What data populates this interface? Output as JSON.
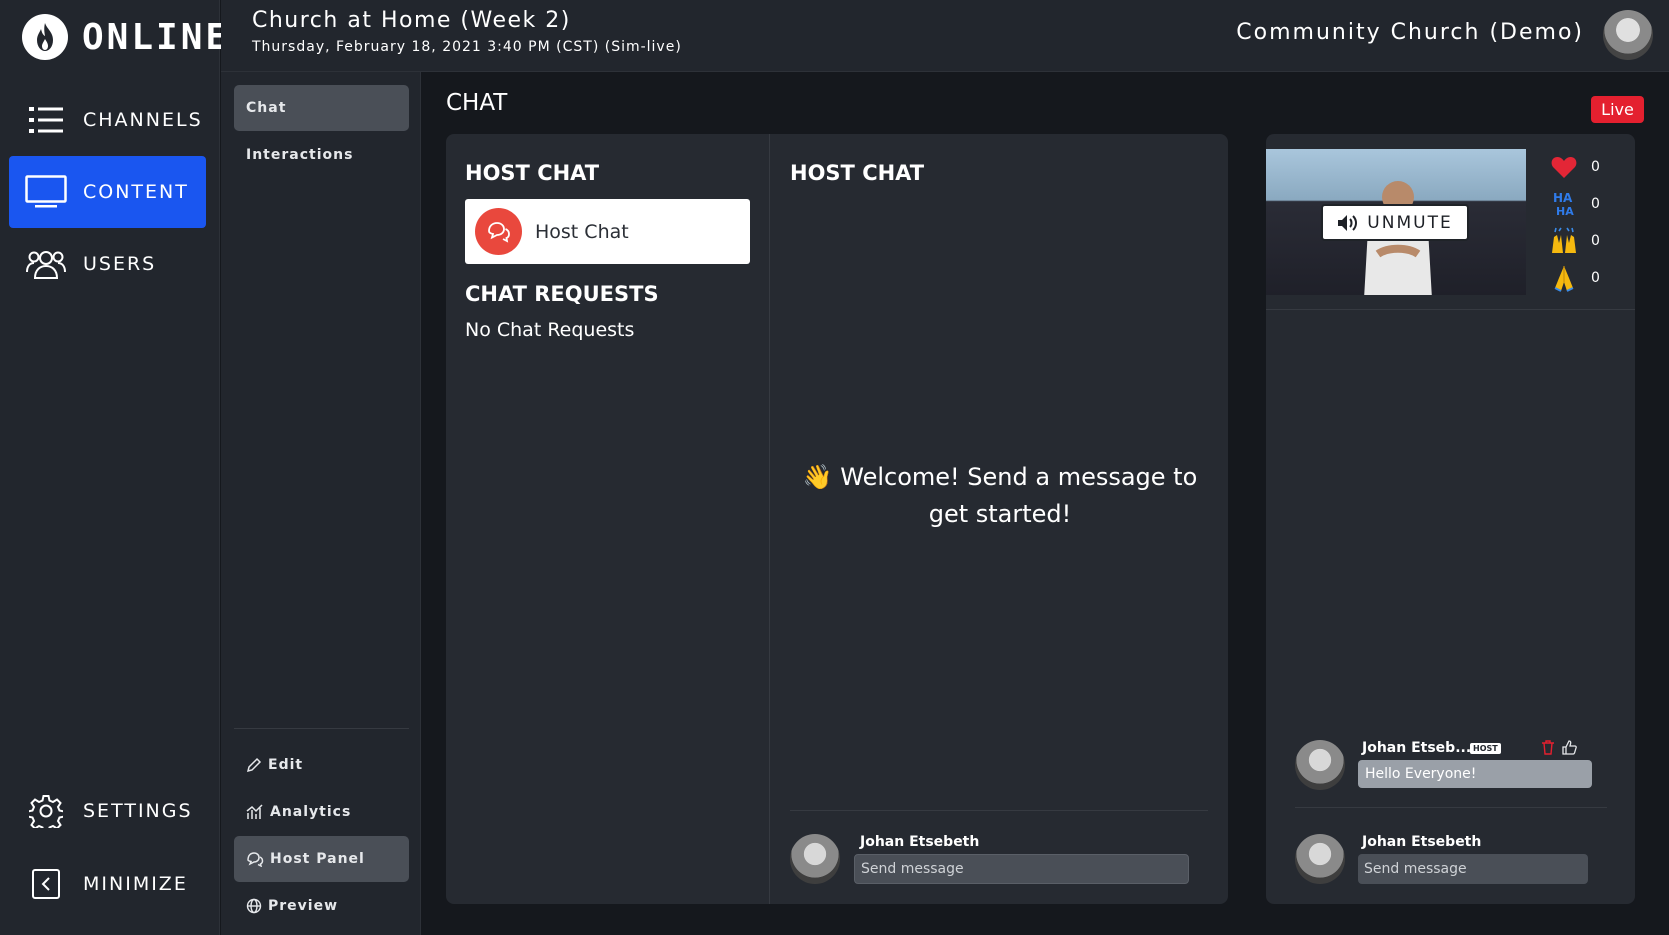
{
  "brand": {
    "logo_text": "ONLINE"
  },
  "nav": {
    "channels": "CHANNELS",
    "content": "CONTENT",
    "users": "USERS",
    "settings": "SETTINGS",
    "minimize": "MINIMIZE"
  },
  "subnav": {
    "chat": "Chat",
    "interactions": "Interactions",
    "edit": "Edit",
    "analytics": "Analytics",
    "host_panel": "Host Panel",
    "preview": "Preview"
  },
  "header": {
    "title": "Church at Home (Week 2)",
    "date": "Thursday, February 18, 2021 3:40 PM (CST) (Sim-live)",
    "org": "Community Church (Demo)"
  },
  "main": {
    "title": "CHAT",
    "live_badge": "Live",
    "host_chat_heading": "HOST CHAT",
    "host_chat_item": "Host Chat",
    "chat_requests_heading": "CHAT REQUESTS",
    "no_requests": "No Chat Requests",
    "right_heading": "HOST CHAT",
    "welcome_emoji": "👋",
    "welcome": "Welcome! Send a message to get started!",
    "compose_name": "Johan Etsebeth",
    "compose_placeholder": "Send message"
  },
  "preview": {
    "unmute": "UNMUTE",
    "reactions": [
      {
        "icon": "heart-icon",
        "count": "0"
      },
      {
        "icon": "haha-icon",
        "count": "0"
      },
      {
        "icon": "raised-hands-icon",
        "count": "0"
      },
      {
        "icon": "praying-hands-icon",
        "count": "0"
      }
    ],
    "message": {
      "name": "Johan Etseb...",
      "tag": "HOST",
      "text": "Hello Everyone!"
    },
    "compose_name": "Johan Etsebeth",
    "compose_placeholder": "Send message"
  },
  "colors": {
    "accent": "#1a56f0",
    "live": "#e4202f",
    "chat_icon": "#e9483d"
  }
}
